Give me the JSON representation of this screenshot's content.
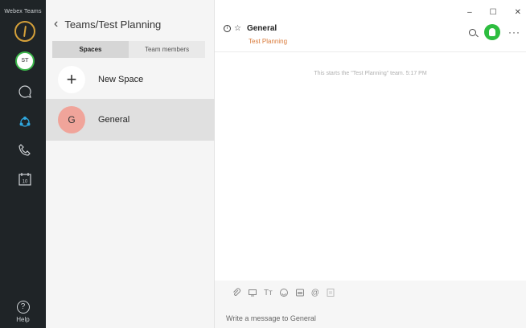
{
  "app": {
    "brand": "Webex Teams"
  },
  "rail": {
    "avatar_initials": "ST",
    "help_label": "Help",
    "help_glyph": "?"
  },
  "panel": {
    "title": "Teams/Test Planning",
    "tabs": [
      {
        "label": "Spaces",
        "active": true
      },
      {
        "label": "Team members",
        "active": false
      }
    ],
    "new_space": {
      "label": "New Space",
      "icon_glyph": "+"
    },
    "spaces": [
      {
        "initial": "G",
        "name": "General",
        "selected": true
      }
    ]
  },
  "window": {
    "minimize": "–",
    "maximize": "☐",
    "close": "✕"
  },
  "conversation": {
    "title": "General",
    "subtitle": "Test Planning",
    "system_message": "This starts the \"Test Planning\" team. 5:17 PM",
    "more_glyph": "···",
    "composer": {
      "placeholder": "Write a message to General",
      "tools": [
        "attach-icon",
        "screen-share-icon",
        "text-format-icon",
        "emoji-icon",
        "gif-icon",
        "mention-icon",
        "whiteboard-icon"
      ]
    }
  },
  "colors": {
    "rail_bg": "#1f2427",
    "accent_green": "#2dbd3f",
    "subtitle_orange": "#d97a3a",
    "selected_bg": "#e0e0e0"
  }
}
